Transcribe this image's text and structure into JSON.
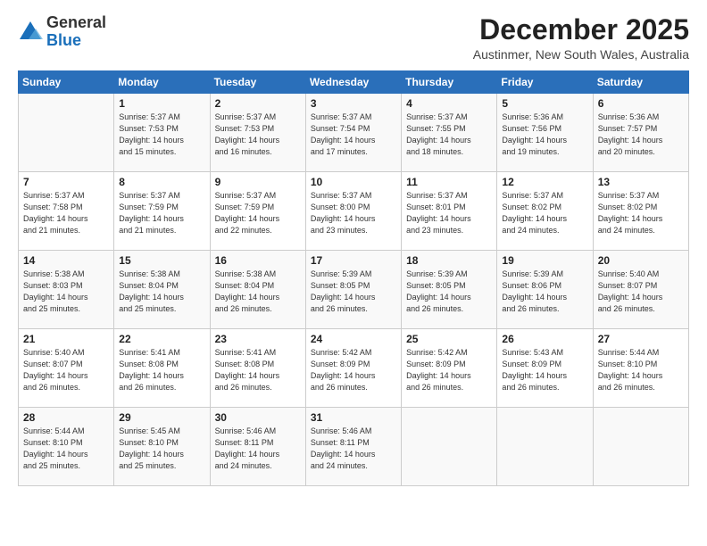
{
  "logo": {
    "general": "General",
    "blue": "Blue"
  },
  "header": {
    "title": "December 2025",
    "subtitle": "Austinmer, New South Wales, Australia"
  },
  "weekdays": [
    "Sunday",
    "Monday",
    "Tuesday",
    "Wednesday",
    "Thursday",
    "Friday",
    "Saturday"
  ],
  "weeks": [
    [
      {
        "day": "",
        "info": ""
      },
      {
        "day": "1",
        "info": "Sunrise: 5:37 AM\nSunset: 7:53 PM\nDaylight: 14 hours\nand 15 minutes."
      },
      {
        "day": "2",
        "info": "Sunrise: 5:37 AM\nSunset: 7:53 PM\nDaylight: 14 hours\nand 16 minutes."
      },
      {
        "day": "3",
        "info": "Sunrise: 5:37 AM\nSunset: 7:54 PM\nDaylight: 14 hours\nand 17 minutes."
      },
      {
        "day": "4",
        "info": "Sunrise: 5:37 AM\nSunset: 7:55 PM\nDaylight: 14 hours\nand 18 minutes."
      },
      {
        "day": "5",
        "info": "Sunrise: 5:36 AM\nSunset: 7:56 PM\nDaylight: 14 hours\nand 19 minutes."
      },
      {
        "day": "6",
        "info": "Sunrise: 5:36 AM\nSunset: 7:57 PM\nDaylight: 14 hours\nand 20 minutes."
      }
    ],
    [
      {
        "day": "7",
        "info": "Sunrise: 5:37 AM\nSunset: 7:58 PM\nDaylight: 14 hours\nand 21 minutes."
      },
      {
        "day": "8",
        "info": "Sunrise: 5:37 AM\nSunset: 7:59 PM\nDaylight: 14 hours\nand 21 minutes."
      },
      {
        "day": "9",
        "info": "Sunrise: 5:37 AM\nSunset: 7:59 PM\nDaylight: 14 hours\nand 22 minutes."
      },
      {
        "day": "10",
        "info": "Sunrise: 5:37 AM\nSunset: 8:00 PM\nDaylight: 14 hours\nand 23 minutes."
      },
      {
        "day": "11",
        "info": "Sunrise: 5:37 AM\nSunset: 8:01 PM\nDaylight: 14 hours\nand 23 minutes."
      },
      {
        "day": "12",
        "info": "Sunrise: 5:37 AM\nSunset: 8:02 PM\nDaylight: 14 hours\nand 24 minutes."
      },
      {
        "day": "13",
        "info": "Sunrise: 5:37 AM\nSunset: 8:02 PM\nDaylight: 14 hours\nand 24 minutes."
      }
    ],
    [
      {
        "day": "14",
        "info": "Sunrise: 5:38 AM\nSunset: 8:03 PM\nDaylight: 14 hours\nand 25 minutes."
      },
      {
        "day": "15",
        "info": "Sunrise: 5:38 AM\nSunset: 8:04 PM\nDaylight: 14 hours\nand 25 minutes."
      },
      {
        "day": "16",
        "info": "Sunrise: 5:38 AM\nSunset: 8:04 PM\nDaylight: 14 hours\nand 26 minutes."
      },
      {
        "day": "17",
        "info": "Sunrise: 5:39 AM\nSunset: 8:05 PM\nDaylight: 14 hours\nand 26 minutes."
      },
      {
        "day": "18",
        "info": "Sunrise: 5:39 AM\nSunset: 8:05 PM\nDaylight: 14 hours\nand 26 minutes."
      },
      {
        "day": "19",
        "info": "Sunrise: 5:39 AM\nSunset: 8:06 PM\nDaylight: 14 hours\nand 26 minutes."
      },
      {
        "day": "20",
        "info": "Sunrise: 5:40 AM\nSunset: 8:07 PM\nDaylight: 14 hours\nand 26 minutes."
      }
    ],
    [
      {
        "day": "21",
        "info": "Sunrise: 5:40 AM\nSunset: 8:07 PM\nDaylight: 14 hours\nand 26 minutes."
      },
      {
        "day": "22",
        "info": "Sunrise: 5:41 AM\nSunset: 8:08 PM\nDaylight: 14 hours\nand 26 minutes."
      },
      {
        "day": "23",
        "info": "Sunrise: 5:41 AM\nSunset: 8:08 PM\nDaylight: 14 hours\nand 26 minutes."
      },
      {
        "day": "24",
        "info": "Sunrise: 5:42 AM\nSunset: 8:09 PM\nDaylight: 14 hours\nand 26 minutes."
      },
      {
        "day": "25",
        "info": "Sunrise: 5:42 AM\nSunset: 8:09 PM\nDaylight: 14 hours\nand 26 minutes."
      },
      {
        "day": "26",
        "info": "Sunrise: 5:43 AM\nSunset: 8:09 PM\nDaylight: 14 hours\nand 26 minutes."
      },
      {
        "day": "27",
        "info": "Sunrise: 5:44 AM\nSunset: 8:10 PM\nDaylight: 14 hours\nand 26 minutes."
      }
    ],
    [
      {
        "day": "28",
        "info": "Sunrise: 5:44 AM\nSunset: 8:10 PM\nDaylight: 14 hours\nand 25 minutes."
      },
      {
        "day": "29",
        "info": "Sunrise: 5:45 AM\nSunset: 8:10 PM\nDaylight: 14 hours\nand 25 minutes."
      },
      {
        "day": "30",
        "info": "Sunrise: 5:46 AM\nSunset: 8:11 PM\nDaylight: 14 hours\nand 24 minutes."
      },
      {
        "day": "31",
        "info": "Sunrise: 5:46 AM\nSunset: 8:11 PM\nDaylight: 14 hours\nand 24 minutes."
      },
      {
        "day": "",
        "info": ""
      },
      {
        "day": "",
        "info": ""
      },
      {
        "day": "",
        "info": ""
      }
    ]
  ]
}
